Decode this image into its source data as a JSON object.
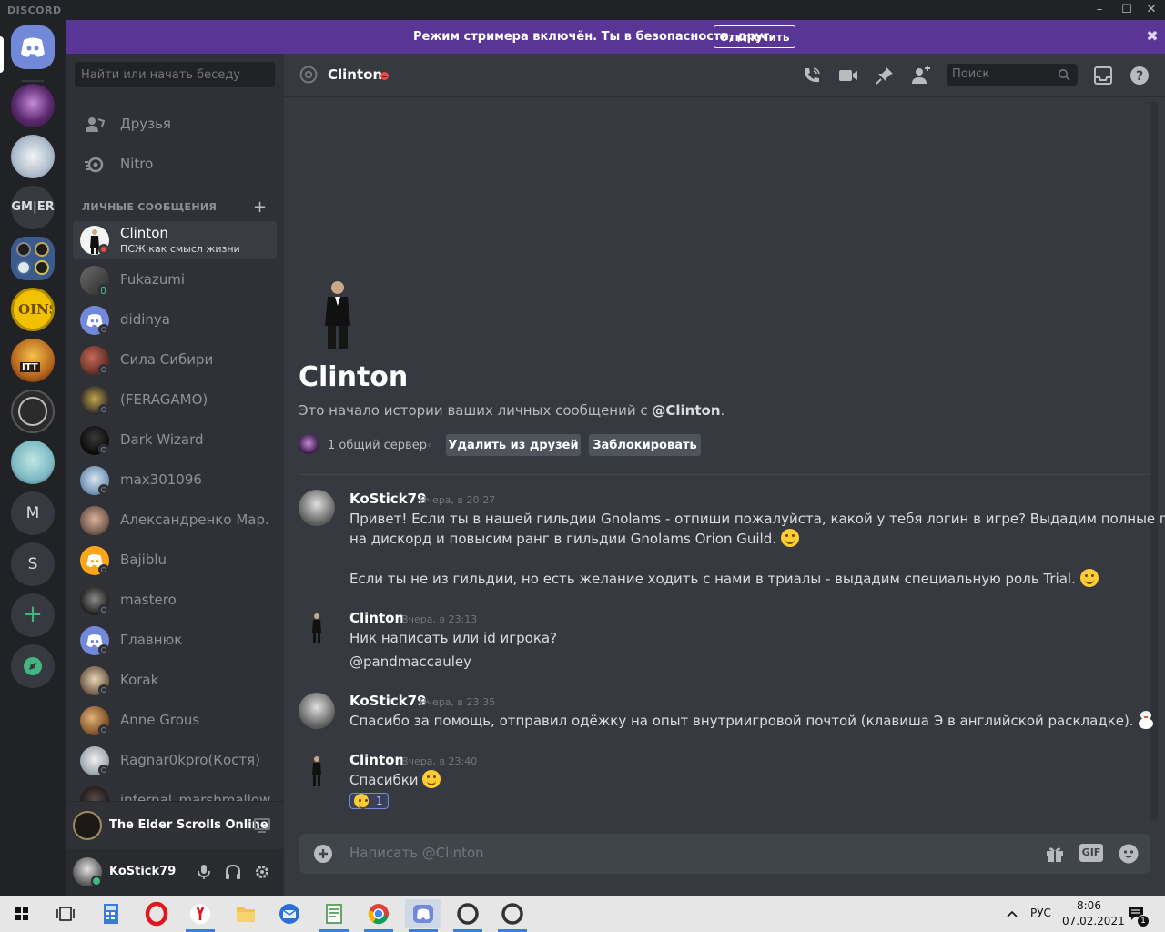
{
  "app": {
    "brand": "DISCORD"
  },
  "banner": {
    "text": "Режим стримера включён. Ты в безопасности, друг.",
    "button": "Отключить"
  },
  "guilds": {
    "gm_label": "GM|ER",
    "m_label": "M",
    "s_label": "S"
  },
  "sidebar": {
    "search_placeholder": "Найти или начать беседу",
    "nav": [
      "Друзья",
      "Nitro"
    ],
    "dm_header": "ЛИЧНЫЕ СООБЩЕНИЯ",
    "dms": [
      {
        "name": "Clinton",
        "sub": "ПСЖ как смысл жизни"
      },
      {
        "name": "Fukazumi"
      },
      {
        "name": "didinya"
      },
      {
        "name": "Сила Сибири"
      },
      {
        "name": "(FERAGAMO)"
      },
      {
        "name": "Dark Wizard"
      },
      {
        "name": "max301096"
      },
      {
        "name": "Александренко Мар..."
      },
      {
        "name": "Bajiblu"
      },
      {
        "name": "mastero"
      },
      {
        "name": "Главнюк"
      },
      {
        "name": "Korak"
      },
      {
        "name": "Anne Grous"
      },
      {
        "name": "Ragnar0kpro(Костя)"
      },
      {
        "name": "infernal_marshmallow"
      }
    ],
    "activity": "The Elder Scrolls Online",
    "user": "KoStick79"
  },
  "chat": {
    "title": "Clinton",
    "search_placeholder": "Поиск",
    "welcome_name": "Clinton",
    "welcome_prefix": "Это начало истории ваших личных сообщений с ",
    "welcome_mention": "@Clinton",
    "welcome_suffix": ".",
    "mutual": "1 общий сервер",
    "remove_friend": "Удалить из друзей",
    "block": "Заблокировать",
    "messages": [
      {
        "author": "KoStick79",
        "time": "Вчера, в 20:27",
        "lines": [
          "Привет! Если ты в нашей гильдии Gnolams - отпиши пожалуйста, какой у тебя логин в игре? Выдадим полные права",
          "на дискорд и повысим ранг в гильдии Gnolams Orion Guild.",
          "Если ты не из гильдии, но есть желание ходить с нами в триалы - выдадим специальную роль Trial."
        ]
      },
      {
        "author": "Clinton",
        "time": "Вчера, в 23:13",
        "lines": [
          "Ник написать или id игрока?",
          "@pandmaccauley"
        ]
      },
      {
        "author": "KoStick79",
        "time": "Вчера, в 23:35",
        "lines": [
          "Спасибо за помощь, отправил одёжку на опыт внутриигровой почтой (клавиша Э в английской раскладке)."
        ]
      },
      {
        "author": "Clinton",
        "time": "Вчера, в 23:40",
        "lines": [
          "Спасибки"
        ],
        "reaction_count": "1"
      }
    ],
    "composer_placeholder": "Написать @Clinton",
    "gif_label": "GIF"
  },
  "taskbar": {
    "lang": "РУС",
    "time": "8:06",
    "date": "07.02.2021",
    "notif_count": "1"
  }
}
